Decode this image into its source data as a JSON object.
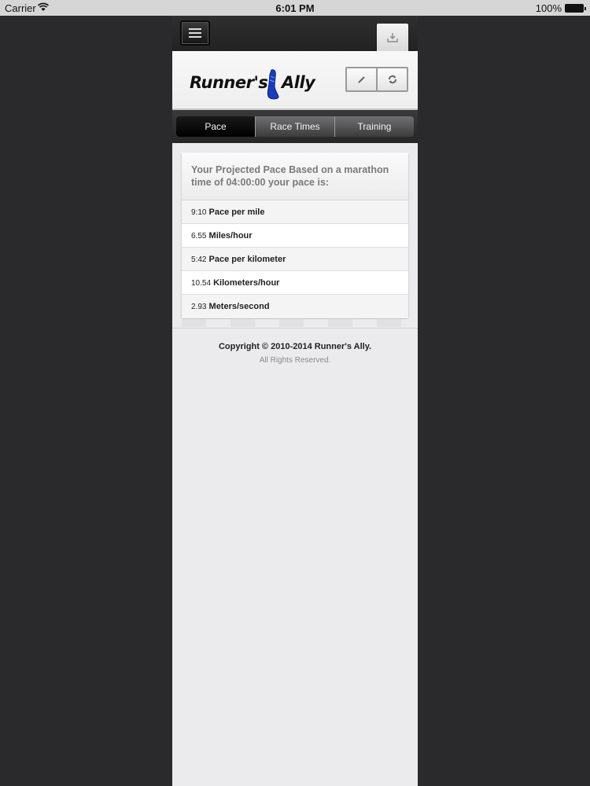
{
  "status_bar": {
    "carrier": "Carrier",
    "time": "6:01 PM",
    "battery": "100%"
  },
  "toolbar": {
    "menu_icon": "hamburger-icon",
    "download_icon": "download-icon"
  },
  "header": {
    "logo_left": "Runner's",
    "logo_right": "Ally",
    "logo_color": "#1a3dbf",
    "tools": [
      "pencil-icon",
      "refresh-icon"
    ]
  },
  "tabs": [
    {
      "label": "Pace",
      "active": true
    },
    {
      "label": "Race Times",
      "active": false
    },
    {
      "label": "Training",
      "active": false
    }
  ],
  "results": {
    "heading": "Your Projected Pace Based on a marathon time of 04:00:00 your pace is:",
    "rows": [
      {
        "value": "9:10",
        "unit": "Pace per mile"
      },
      {
        "value": "6.55",
        "unit": "Miles/hour"
      },
      {
        "value": "5:42",
        "unit": "Pace per kilometer"
      },
      {
        "value": "10.54",
        "unit": "Kilometers/hour"
      },
      {
        "value": "2.93",
        "unit": "Meters/second"
      }
    ]
  },
  "footer": {
    "copyright": "Copyright © 2010-2014 Runner's Ally.",
    "rights": "All Rights Reserved."
  }
}
